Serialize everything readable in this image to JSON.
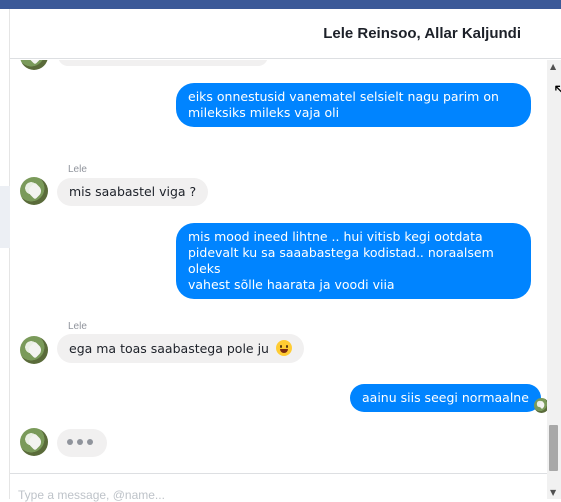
{
  "header": {
    "title": "Lele Reinsoo, Allar Kaljundi"
  },
  "messages": [
    {
      "id": "m1",
      "direction": "out",
      "lines": [
        "eiks onnestusid vanematel selsielt nagu parim on",
        "mileksiks mileks vaja oli"
      ]
    },
    {
      "id": "m2",
      "direction": "in",
      "sender": "Lele",
      "text": "mis saabastel viga ?"
    },
    {
      "id": "m3",
      "direction": "out",
      "lines": [
        "mis mood ineed lihtne .. hui vitisb kegi ootdata",
        "pidevalt ku sa saaabastega kodistad.. noraalsem oleks",
        "vahest sõlle haarata ja voodi viia"
      ]
    },
    {
      "id": "m4",
      "direction": "in",
      "sender": "Lele",
      "text": "ega ma toas saabastega pole ju",
      "emoji": "grinning-face"
    },
    {
      "id": "m5",
      "direction": "out",
      "text": "aainu siis seegi normaalne"
    }
  ],
  "typing_indicator": {
    "visible": true
  },
  "composer": {
    "placeholder": "Type a message, @name..."
  },
  "colors": {
    "outgoing_bubble": "#0084ff",
    "incoming_bubble": "#f1f0f0",
    "top_bar": "#3b5998"
  }
}
